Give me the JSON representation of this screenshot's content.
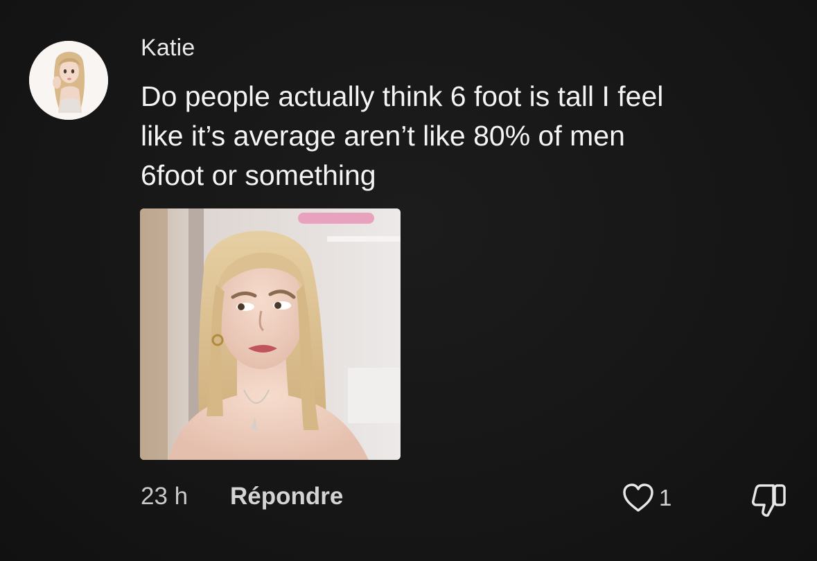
{
  "comment": {
    "author": "Katie",
    "text_lines": [
      "Do people actually think 6 foot is tall I feel",
      "like it’s average aren’t like 80% of men",
      "6foot or something"
    ],
    "timestamp": "23 h",
    "reply_label": "Répondre",
    "like_count": "1"
  },
  "icons": {
    "like": "heart-outline-icon",
    "dislike": "thumbs-down-outline-icon"
  },
  "colors": {
    "background": "#161616",
    "text": "#f4f4f4",
    "muted": "#c9c9c9"
  }
}
